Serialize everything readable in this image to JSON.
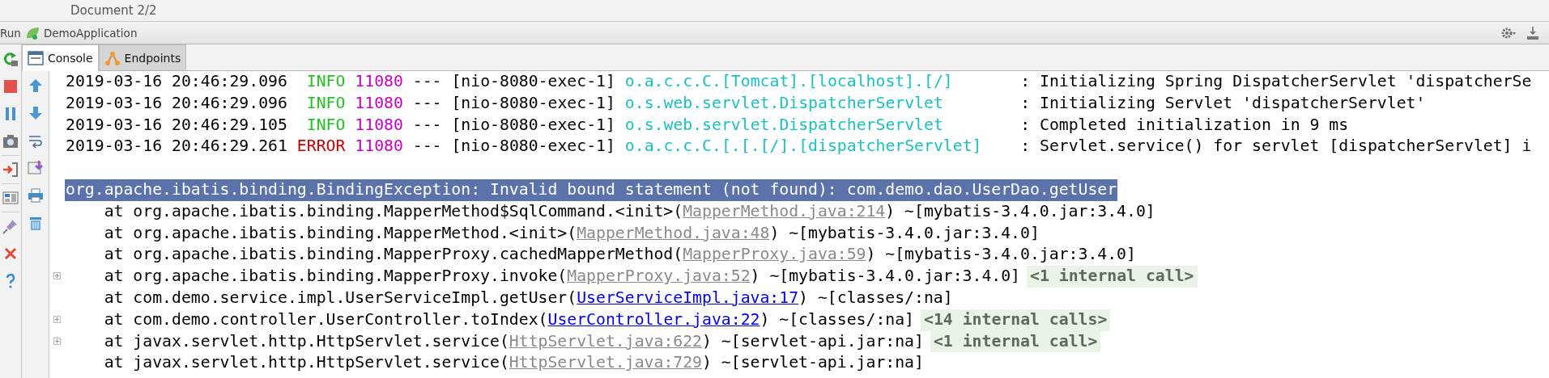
{
  "window": {
    "title": "Document 2/2"
  },
  "run_bar": {
    "label": "Run",
    "config": "DemoApplication"
  },
  "tabs": [
    {
      "label": "Console",
      "selected": true
    },
    {
      "label": "Endpoints",
      "selected": false
    }
  ],
  "log_lines": [
    {
      "timestamp": "2019-03-16 20:46:29.096",
      "severity": "INFO",
      "kind": "info",
      "pid": "11080",
      "separator": "---",
      "thread": "[nio-8080-exec-1]",
      "logger": "o.a.c.c.C.[Tomcat].[localhost].[/]",
      "colon": ":",
      "message": "Initializing Spring DispatcherServlet 'dispatcherSe"
    },
    {
      "timestamp": "2019-03-16 20:46:29.096",
      "severity": "INFO",
      "kind": "info",
      "pid": "11080",
      "separator": "---",
      "thread": "[nio-8080-exec-1]",
      "logger": "o.s.web.servlet.DispatcherServlet",
      "colon": ":",
      "message": "Initializing Servlet 'dispatcherServlet'"
    },
    {
      "timestamp": "2019-03-16 20:46:29.105",
      "severity": "INFO",
      "kind": "info",
      "pid": "11080",
      "separator": "---",
      "thread": "[nio-8080-exec-1]",
      "logger": "o.s.web.servlet.DispatcherServlet",
      "colon": ":",
      "message": "Completed initialization in 9 ms"
    },
    {
      "timestamp": "2019-03-16 20:46:29.261",
      "severity": "ERROR",
      "kind": "error",
      "pid": "11080",
      "separator": "---",
      "thread": "[nio-8080-exec-1]",
      "logger": "o.a.c.c.C.[.[.[/].[dispatcherServlet]",
      "colon": ":",
      "message": "Servlet.service() for servlet [dispatcherServlet] i"
    }
  ],
  "exception": {
    "text": "org.apache.ibatis.binding.BindingException: Invalid bound statement (not found): com.demo.dao.UserDao.getUser",
    "selected": true
  },
  "trace": [
    {
      "prefix": "at org.apache.ibatis.binding.MapperMethod$SqlCommand.<init>(",
      "link": {
        "text": "MapperMethod.java:214",
        "kind": "library"
      },
      "suffix": ") ~[mybatis-3.4.0.jar:3.4.0]",
      "foldable": false
    },
    {
      "prefix": "at org.apache.ibatis.binding.MapperMethod.<init>(",
      "link": {
        "text": "MapperMethod.java:48",
        "kind": "library"
      },
      "suffix": ") ~[mybatis-3.4.0.jar:3.4.0]",
      "foldable": false
    },
    {
      "prefix": "at org.apache.ibatis.binding.MapperProxy.cachedMapperMethod(",
      "link": {
        "text": "MapperProxy.java:59",
        "kind": "library"
      },
      "suffix": ") ~[mybatis-3.4.0.jar:3.4.0]",
      "foldable": false
    },
    {
      "prefix": "at org.apache.ibatis.binding.MapperProxy.invoke(",
      "link": {
        "text": "MapperProxy.java:52",
        "kind": "library"
      },
      "suffix": ") ~[mybatis-3.4.0.jar:3.4.0]",
      "internal": "<1 internal call>",
      "foldable": true
    },
    {
      "prefix": "at com.demo.service.impl.UserServiceImpl.getUser(",
      "link": {
        "text": "UserServiceImpl.java:17",
        "kind": "project"
      },
      "suffix": ") ~[classes/:na]",
      "foldable": false
    },
    {
      "prefix": "at com.demo.controller.UserController.toIndex(",
      "link": {
        "text": "UserController.java:22",
        "kind": "project"
      },
      "suffix": ") ~[classes/:na]",
      "internal": "<14 internal calls>",
      "foldable": true
    },
    {
      "prefix": "at javax.servlet.http.HttpServlet.service(",
      "link": {
        "text": "HttpServlet.java:622",
        "kind": "library"
      },
      "suffix": ") ~[servlet-api.jar:na]",
      "internal": "<1 internal call>",
      "foldable": true
    },
    {
      "prefix": "at javax.servlet.http.HttpServlet.service(",
      "link": {
        "text": "HttpServlet.java:729",
        "kind": "library"
      },
      "suffix": ") ~[servlet-api.jar:na]",
      "foldable": false
    }
  ]
}
